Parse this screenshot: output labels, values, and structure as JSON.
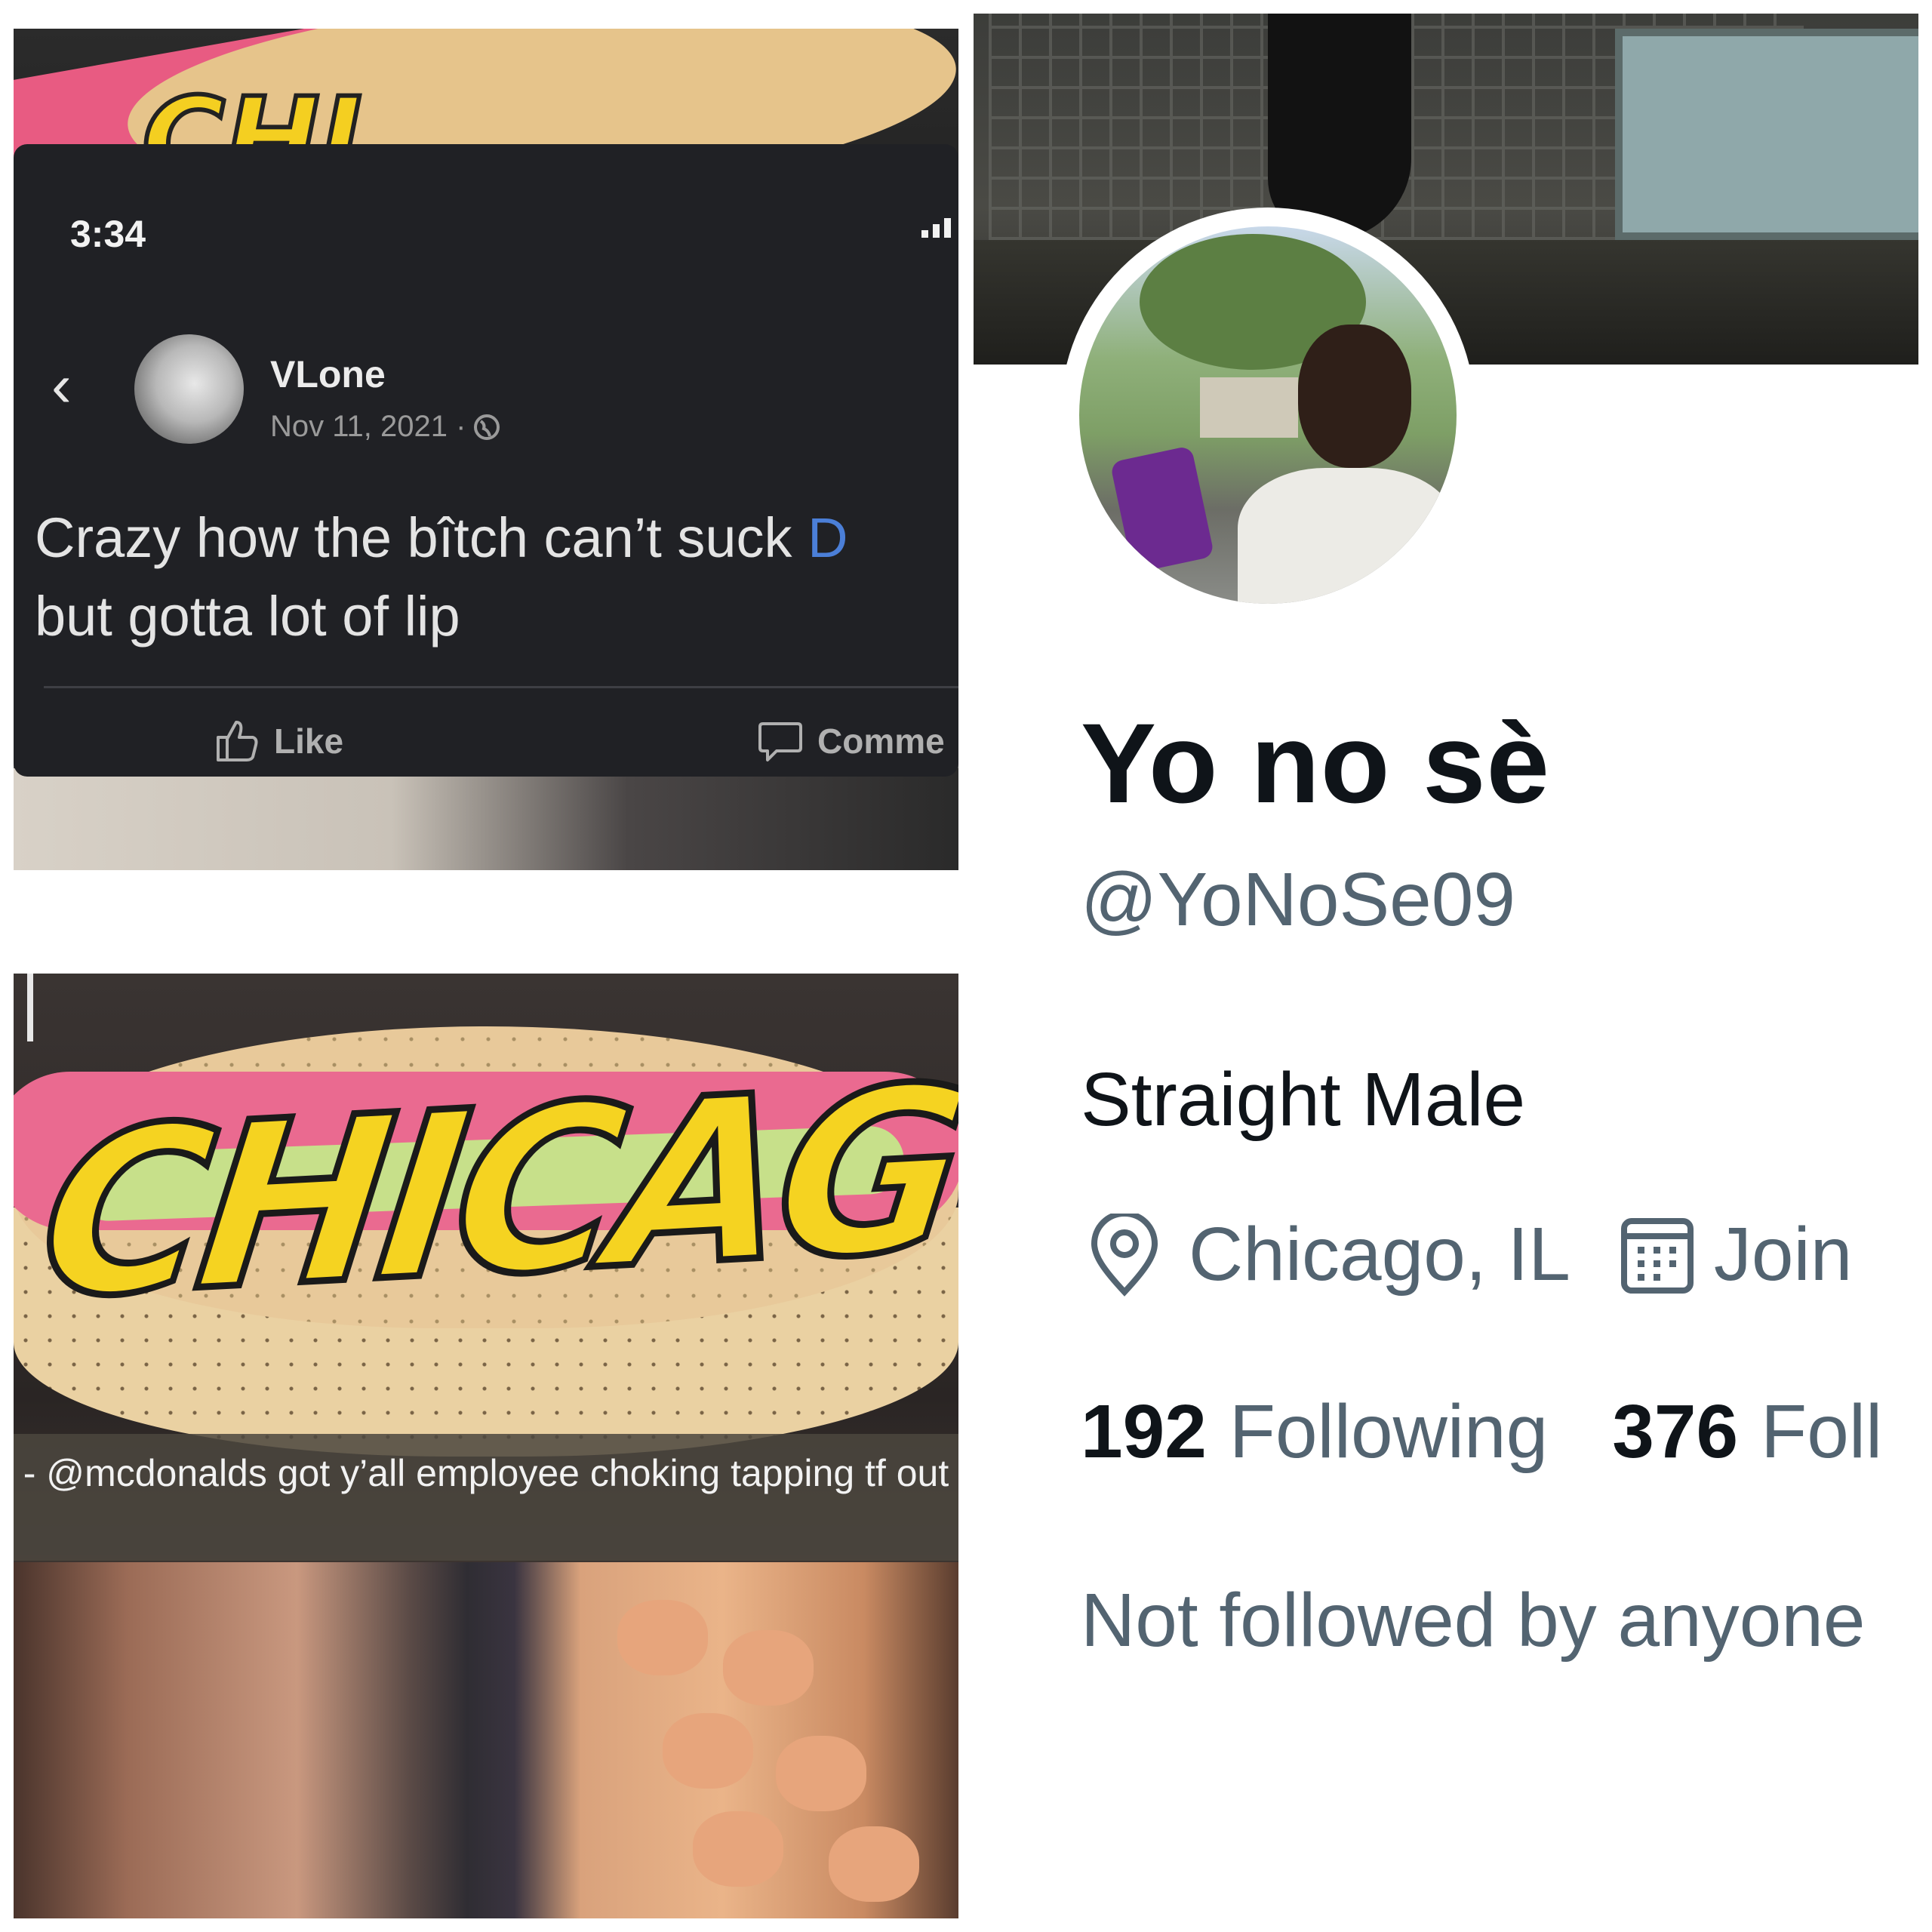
{
  "facebook_post": {
    "status_time": "3:34",
    "author_name": "VLone",
    "post_date": "Nov 11, 2021 ·",
    "post_text_line1": "Crazy how the bîtch can’t suck ",
    "post_text_cutoff": "D",
    "post_text_line2": "but gotta lot of lip",
    "like_label": "Like",
    "comment_label": "Comme",
    "icons": [
      "location-arrow-icon",
      "signal-icon",
      "back-chevron-icon",
      "globe-icon",
      "thumbs-up-icon",
      "comment-bubble-icon"
    ]
  },
  "twitter_profile": {
    "display_name": "Yo no sè",
    "handle": "@YoNoSe09",
    "bio": "Straight Male",
    "location": "Chicago, IL",
    "joined_label": "Join",
    "following_count": "192",
    "following_label": "Following",
    "followers_count": "376",
    "followers_label": "Foll",
    "not_followed_text": "Not followed by anyone",
    "icons": [
      "location-pin-icon",
      "calendar-icon"
    ],
    "colors": {
      "name": "#0f1419",
      "secondary": "#536471"
    }
  },
  "snapchat_story": {
    "sticker_word": "CHICAGO",
    "caption": "- @mcdonalds got y’all employee choking tapping tf out"
  }
}
